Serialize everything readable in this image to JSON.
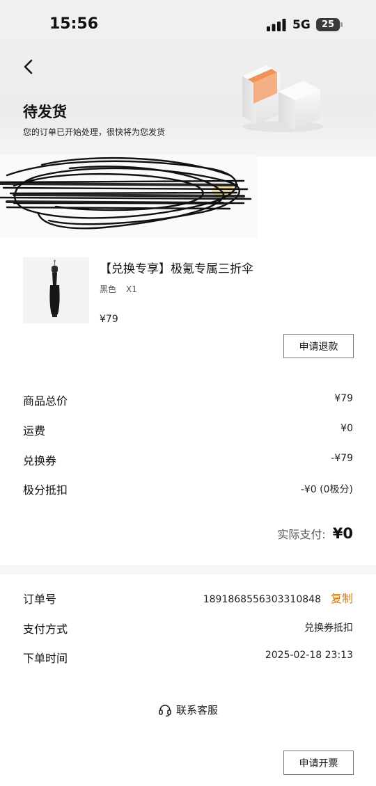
{
  "status_bar": {
    "time": "15:56",
    "network": "5G",
    "battery": "25"
  },
  "order_status": {
    "title": "待发货",
    "subtitle": "您的订单已开始处理，很快将为您发货"
  },
  "product": {
    "title": "【兑换专享】极氪专属三折伞",
    "color": "黑色",
    "quantity": "X1",
    "price": "¥79",
    "refund_label": "申请退款"
  },
  "price_summary": [
    {
      "label": "商品总价",
      "value": "¥79"
    },
    {
      "label": "运费",
      "value": "¥0"
    },
    {
      "label": "兑换券",
      "value": "-¥79"
    },
    {
      "label": "极分抵扣",
      "value": "-¥0 (0极分)"
    }
  ],
  "payment": {
    "label": "实际支付:",
    "value": "¥0"
  },
  "order_info": {
    "order_no_label": "订单号",
    "order_no": "1891868556303310848",
    "copy_label": "复制",
    "pay_method_label": "支付方式",
    "pay_method": "兑换券抵扣",
    "order_time_label": "下单时间",
    "order_time": "2025-02-18 23:13"
  },
  "support_label": "联系客服",
  "invoice_label": "申请开票",
  "colors": {
    "accent": "#c87d1f",
    "box_orange": "#f0925a"
  }
}
